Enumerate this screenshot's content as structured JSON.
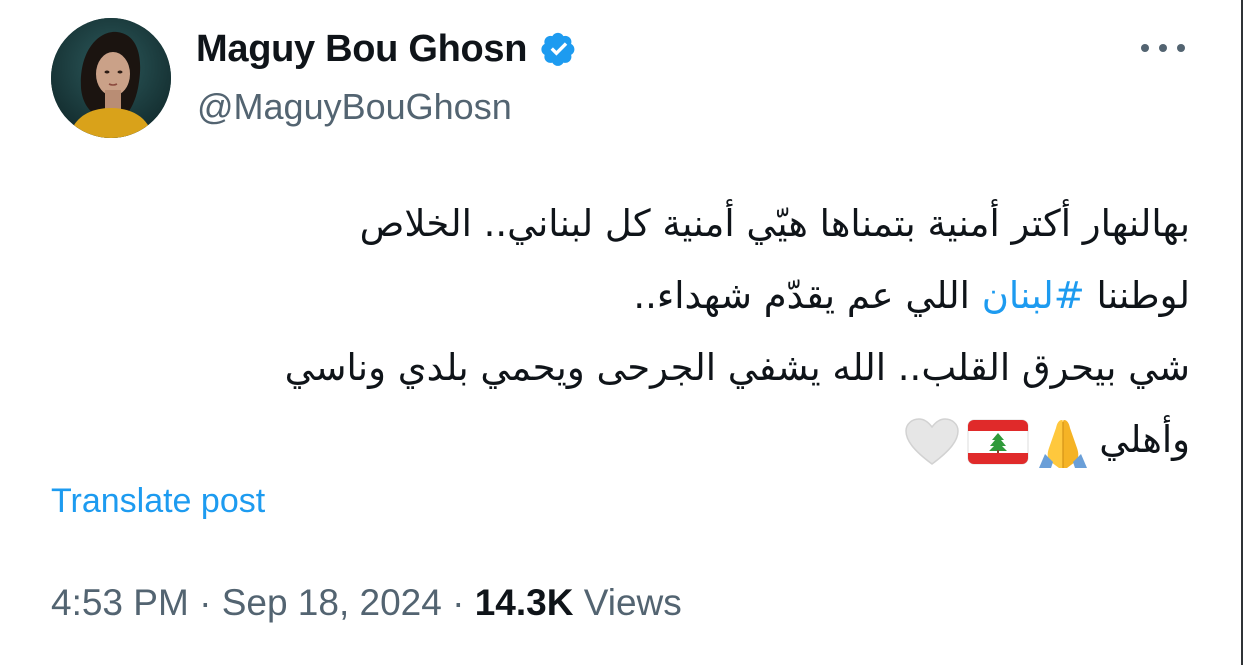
{
  "author": {
    "display_name": "Maguy Bou Ghosn",
    "handle": "@MaguyBouGhosn",
    "verified": true
  },
  "post": {
    "line1": "بهالنهار أكتر أمنية بتمناها هيّي أمنية كل لبناني.. الخلاص",
    "line2_before": "لوطننا ",
    "hashtag": "#لبنان",
    "line2_after": " اللي عم يقدّم شهداء..",
    "line3": "شي بيحرق القلب.. الله يشفي الجرحى ويحمي بلدي وناسي",
    "line4": "وأهلي",
    "emojis": [
      "folded-hands-icon",
      "lebanon-flag-icon",
      "white-heart-icon"
    ]
  },
  "translate_label": "Translate post",
  "meta": {
    "time": "4:53 PM",
    "separator1": " · ",
    "date": "Sep 18, 2024",
    "separator2": " · ",
    "views_count": "14.3K",
    "views_label": " Views"
  },
  "colors": {
    "text": "#0f1419",
    "muted": "#536471",
    "accent": "#1d9bf0"
  }
}
